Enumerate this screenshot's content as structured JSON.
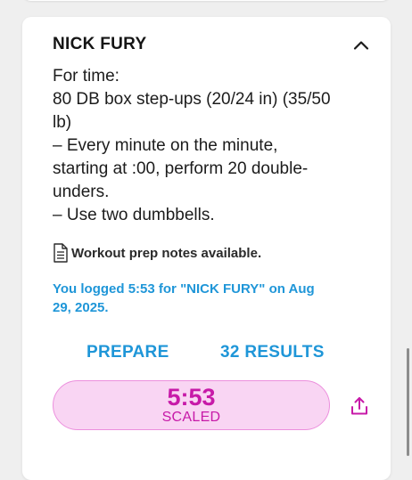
{
  "workout": {
    "title": "NICK FURY",
    "description_lines": [
      "For time:",
      "80 DB box step-ups (20/24 in) (35/50",
      "lb)",
      "– Every minute on the minute,",
      "starting at :00, perform 20 double-",
      "unders.",
      "– Use two dumbbells."
    ],
    "notes_label": "Workout prep notes available.",
    "logged_line_1": "You logged 5:53 for \"NICK FURY\" on Aug",
    "logged_line_2": "29, 2025.",
    "prepare_label": "PREPARE",
    "results_label": "32 RESULTS",
    "result": {
      "time": "5:53",
      "scale": "SCALED"
    }
  },
  "icons": {
    "collapse": "chevron-up-icon",
    "notes": "document-icon",
    "share": "share-icon"
  },
  "colors": {
    "accent_blue": "#1f96d8",
    "result_text": "#c71aa8",
    "result_bg": "#f9d5f3",
    "result_border": "#ec8fdd"
  }
}
